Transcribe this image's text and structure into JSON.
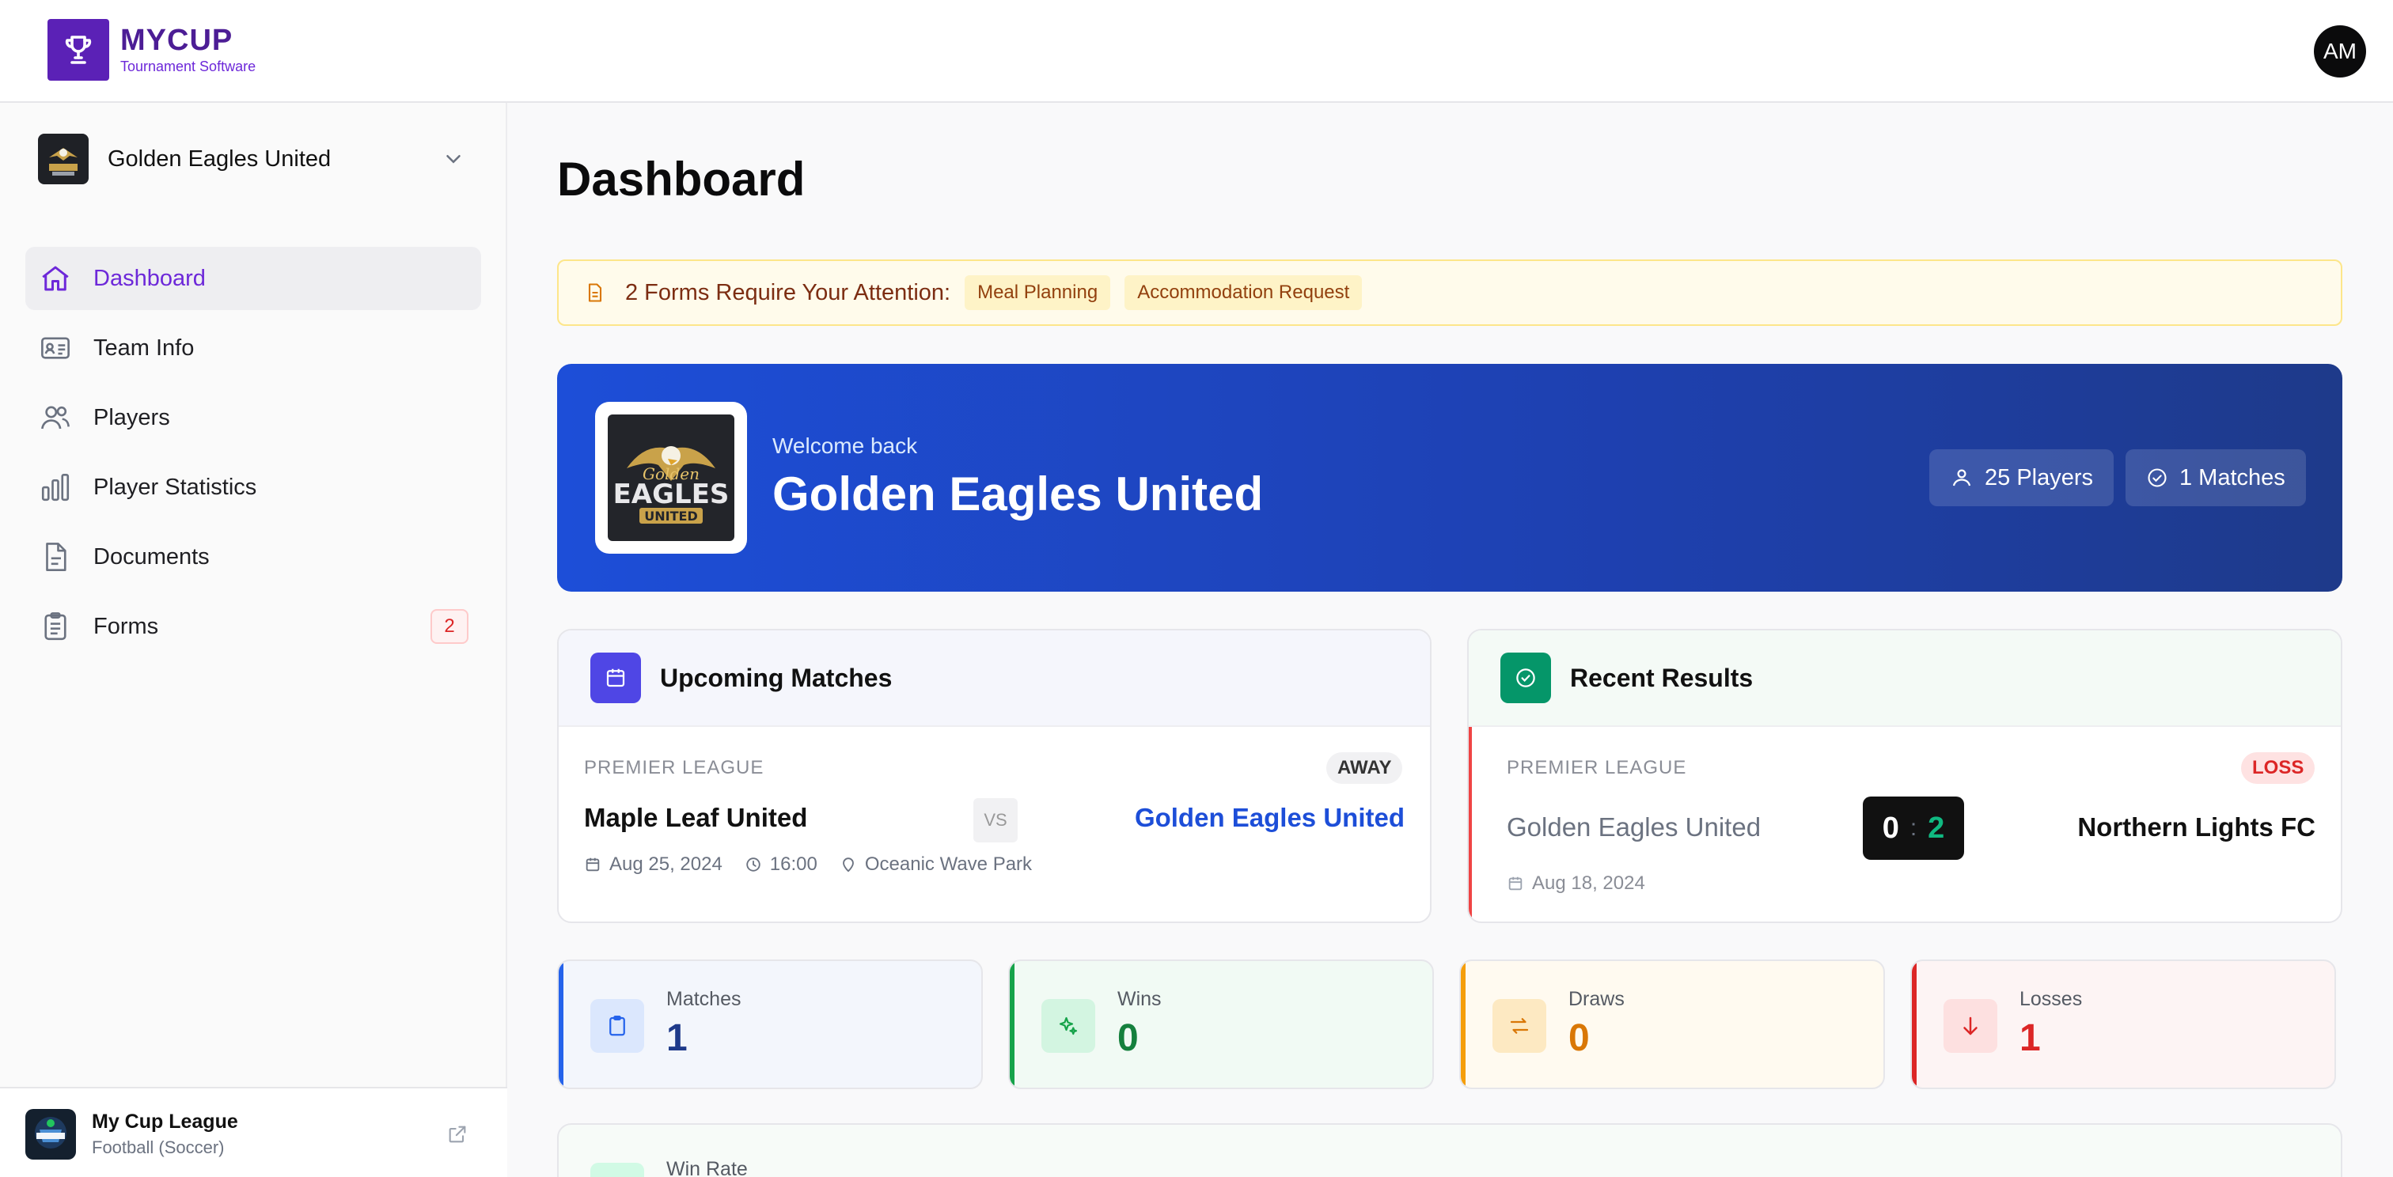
{
  "brand": {
    "name": "MYCUP",
    "sub": "Tournament Software"
  },
  "user": {
    "initials": "AM"
  },
  "sidebar": {
    "team_name": "Golden Eagles United",
    "items": [
      {
        "label": "Dashboard",
        "icon": "home-icon"
      },
      {
        "label": "Team Info",
        "icon": "id-card-icon"
      },
      {
        "label": "Players",
        "icon": "users-icon"
      },
      {
        "label": "Player Statistics",
        "icon": "bar-chart-icon"
      },
      {
        "label": "Documents",
        "icon": "document-icon"
      },
      {
        "label": "Forms",
        "icon": "clipboard-icon",
        "badge": "2"
      }
    ],
    "league": {
      "name": "My Cup League",
      "sport": "Football (Soccer)"
    }
  },
  "page": {
    "title": "Dashboard"
  },
  "alert": {
    "text": "2 Forms Require Your Attention:",
    "chips": [
      "Meal Planning",
      "Accommodation Request"
    ]
  },
  "hero": {
    "welcome": "Welcome back",
    "team": "Golden Eagles United",
    "players": "25 Players",
    "matches": "1 Matches",
    "logo_text": "Golden EAGLES UNITED"
  },
  "upcoming": {
    "title": "Upcoming Matches",
    "league": "PREMIER LEAGUE",
    "tag": "AWAY",
    "home": "Maple Leaf United",
    "vs": "VS",
    "away": "Golden Eagles United",
    "date": "Aug 25, 2024",
    "time": "16:00",
    "venue": "Oceanic Wave Park"
  },
  "recent": {
    "title": "Recent Results",
    "league": "PREMIER LEAGUE",
    "tag": "LOSS",
    "home": "Golden Eagles United",
    "home_score": "0",
    "sep": ":",
    "away_score": "2",
    "away": "Northern Lights FC",
    "date": "Aug 18, 2024"
  },
  "stats": [
    {
      "label": "Matches",
      "value": "1",
      "color": "#2563eb"
    },
    {
      "label": "Wins",
      "value": "0",
      "color": "#16a34a"
    },
    {
      "label": "Draws",
      "value": "0",
      "color": "#f59e0b"
    },
    {
      "label": "Losses",
      "value": "1",
      "color": "#dc2626"
    }
  ],
  "winrate": {
    "label": "Win Rate"
  },
  "colors": {
    "accent": "#6d28d9",
    "hero": "#1d4ed8"
  }
}
